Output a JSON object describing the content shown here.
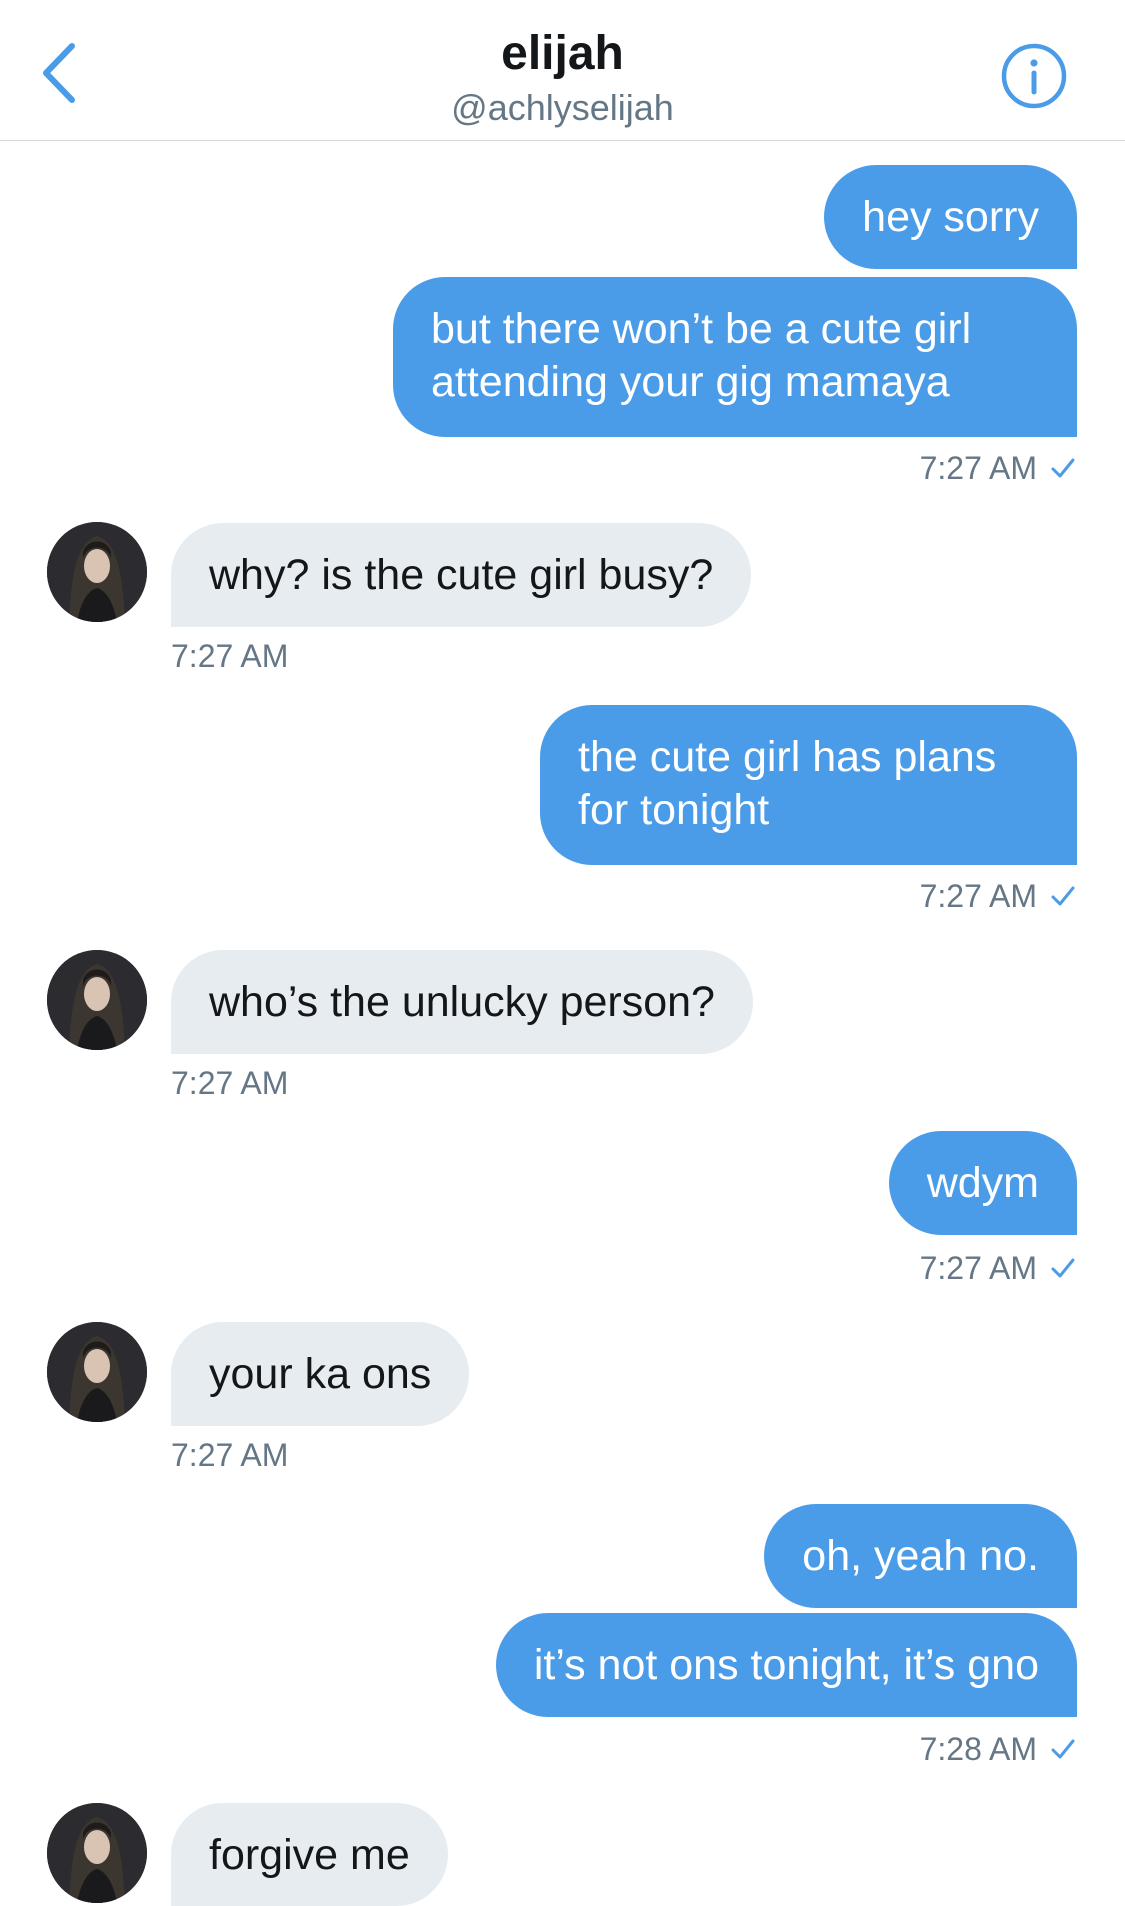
{
  "header": {
    "title": "elijah",
    "handle": "@achlyselijah",
    "back_icon": "chevron-left-icon",
    "info_icon": "info-circle-icon",
    "accent_color": "#4a9ce8"
  },
  "messages": [
    {
      "direction": "out",
      "text": "hey sorry"
    },
    {
      "direction": "out",
      "text": "but there won’t be a cute girl attending your gig mamaya",
      "time": "7:27 AM",
      "read": true
    },
    {
      "direction": "in",
      "text": "why? is the cute girl busy?",
      "time": "7:27 AM"
    },
    {
      "direction": "out",
      "text": "the cute girl has plans for tonight",
      "time": "7:27 AM",
      "read": true
    },
    {
      "direction": "in",
      "text": "who’s the unlucky person?",
      "time": "7:27 AM"
    },
    {
      "direction": "out",
      "text": "wdym",
      "time": "7:27 AM",
      "read": true
    },
    {
      "direction": "in",
      "text": "your ka ons",
      "time": "7:27 AM"
    },
    {
      "direction": "out",
      "text": "oh, yeah no."
    },
    {
      "direction": "out",
      "text": "it’s not ons tonight, it’s gno",
      "time": "7:28 AM",
      "read": true
    },
    {
      "direction": "in",
      "text": "forgive me"
    }
  ],
  "colors": {
    "outgoing_bubble": "#4a9ce8",
    "incoming_bubble": "#e6ecf0",
    "timestamp": "#657786"
  }
}
